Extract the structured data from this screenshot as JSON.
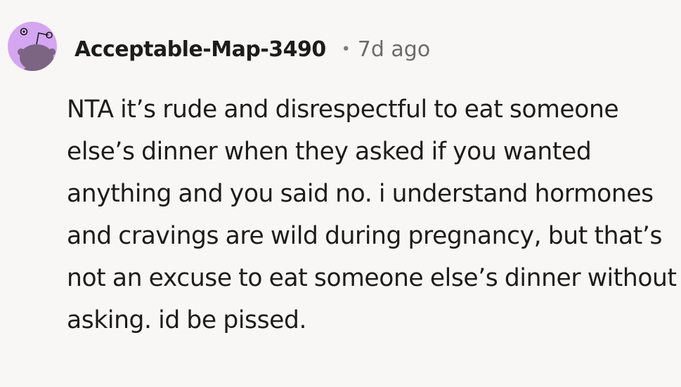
{
  "comment": {
    "author": "Acceptable-Map-3490",
    "separator": "•",
    "timestamp": "7d ago",
    "avatar_icon": "reddit-snoo-avatar-icon",
    "avatar_color": "#d4a5f0",
    "body": "NTA it’s rude and disrespectful to eat someone else’s dinner when they asked if you wanted anything and you said no. i understand hormones and cravings are wild during pregnancy, but that’s not an excuse to eat someone else’s dinner without asking. id be pissed."
  }
}
